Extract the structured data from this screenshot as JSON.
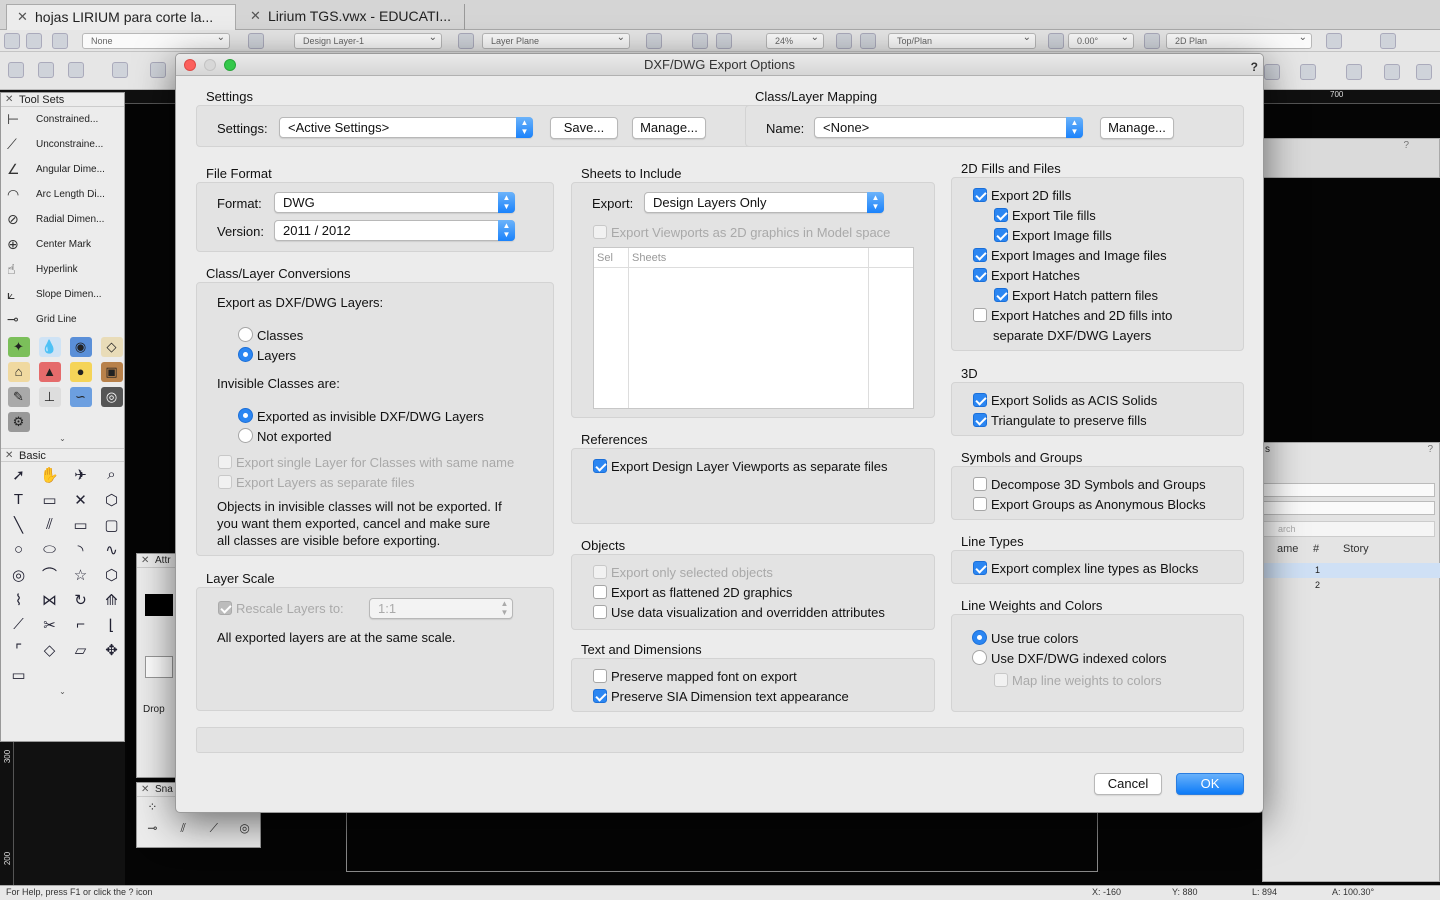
{
  "app": {
    "tabs": [
      {
        "label": "hojas LIRIUM para corte la..."
      },
      {
        "label": "Lirium TGS.vwx - EDUCATI..."
      }
    ],
    "toolbar": {
      "class_value": "None",
      "layer_value": "Design Layer-1",
      "layer_plane": "Layer Plane",
      "zoom": "24%",
      "view": "Top/Plan",
      "angle": "0.00°",
      "render": "2D Plan"
    },
    "ruler": {
      "top_tick": "700",
      "left_tick_1": "300",
      "left_tick_2": "200"
    },
    "status": {
      "help": "For Help, press F1 or click the ? icon",
      "x": "X: -160",
      "y": "Y: 880",
      "l": "L: 894",
      "a": "A: 100.30°"
    },
    "toolsets": {
      "title": "Tool Sets",
      "items": [
        "Constrained...",
        "Unconstraine...",
        "Angular Dime...",
        "Arc Length Di...",
        "Radial Dimen...",
        "Center Mark",
        "Hyperlink",
        "Slope Dimen...",
        "Grid Line"
      ],
      "basic_title": "Basic"
    },
    "attr_title": "Attr",
    "attr_drop": "Drop",
    "snap_title": "Sna",
    "navigation": {
      "col_name": "ame",
      "col_num": "#",
      "col_story": "Story",
      "row1": "1",
      "row2": "2",
      "search": "arch",
      "tab": "s"
    }
  },
  "dialog": {
    "title": "DXF/DWG Export Options",
    "settings": {
      "section": "Settings",
      "label": "Settings:",
      "value": "<Active Settings>",
      "save": "Save...",
      "manage": "Manage..."
    },
    "mapping": {
      "section": "Class/Layer Mapping",
      "label": "Name:",
      "value": "<None>",
      "manage": "Manage..."
    },
    "file_format": {
      "section": "File Format",
      "format_label": "Format:",
      "format_value": "DWG",
      "version_label": "Version:",
      "version_value": "2011 / 2012"
    },
    "conversions": {
      "section": "Class/Layer Conversions",
      "export_as": "Export as DXF/DWG Layers:",
      "classes": "Classes",
      "layers": "Layers",
      "invisible_title": "Invisible Classes are:",
      "exported_invisible": "Exported as invisible DXF/DWG Layers",
      "not_exported": "Not exported",
      "single_layer": "Export single Layer for Classes with same name",
      "separate_files": "Export Layers as separate files",
      "note1": "Objects in invisible classes will not be exported. If",
      "note2": "you want them exported, cancel and make sure",
      "note3": "all classes are visible before exporting."
    },
    "layer_scale": {
      "section": "Layer Scale",
      "rescale": "Rescale Layers to:",
      "scale_value": "1:1",
      "note": "All exported layers are at the same scale."
    },
    "sheets": {
      "section": "Sheets to Include",
      "export_label": "Export:",
      "export_value": "Design Layers Only",
      "viewports": "Export Viewports as 2D graphics in Model space",
      "col_sel": "Sel",
      "col_sheets": "Sheets"
    },
    "references": {
      "section": "References",
      "dlvp": "Export Design Layer Viewports as separate files"
    },
    "objects": {
      "section": "Objects",
      "only_selected": "Export only selected objects",
      "flattened": "Export as flattened 2D graphics",
      "dataviz": "Use data visualization and overridden attributes"
    },
    "text_dims": {
      "section": "Text and Dimensions",
      "mapped_font": "Preserve mapped font on export",
      "sia": "Preserve SIA Dimension text appearance"
    },
    "fills": {
      "section": "2D Fills and Files",
      "fills": "Export 2D fills",
      "tile": "Export Tile fills",
      "image_fills": "Export Image fills",
      "images": "Export Images and Image files",
      "hatches": "Export Hatches",
      "hatch_files": "Export Hatch pattern files",
      "hatch_layers1": "Export Hatches and 2D fills into",
      "hatch_layers2": "separate DXF/DWG Layers"
    },
    "three_d": {
      "section": "3D",
      "acis": "Export Solids as ACIS Solids",
      "triangulate": "Triangulate to preserve fills"
    },
    "symbols": {
      "section": "Symbols and Groups",
      "decompose": "Decompose 3D Symbols and Groups",
      "anon_blocks": "Export Groups as Anonymous Blocks"
    },
    "line_types": {
      "section": "Line Types",
      "complex": "Export complex line types as Blocks"
    },
    "line_weights": {
      "section": "Line Weights and Colors",
      "true_colors": "Use true colors",
      "indexed": "Use DXF/DWG indexed colors",
      "map_weights": "Map line weights to colors"
    },
    "cancel": "Cancel",
    "ok": "OK"
  }
}
